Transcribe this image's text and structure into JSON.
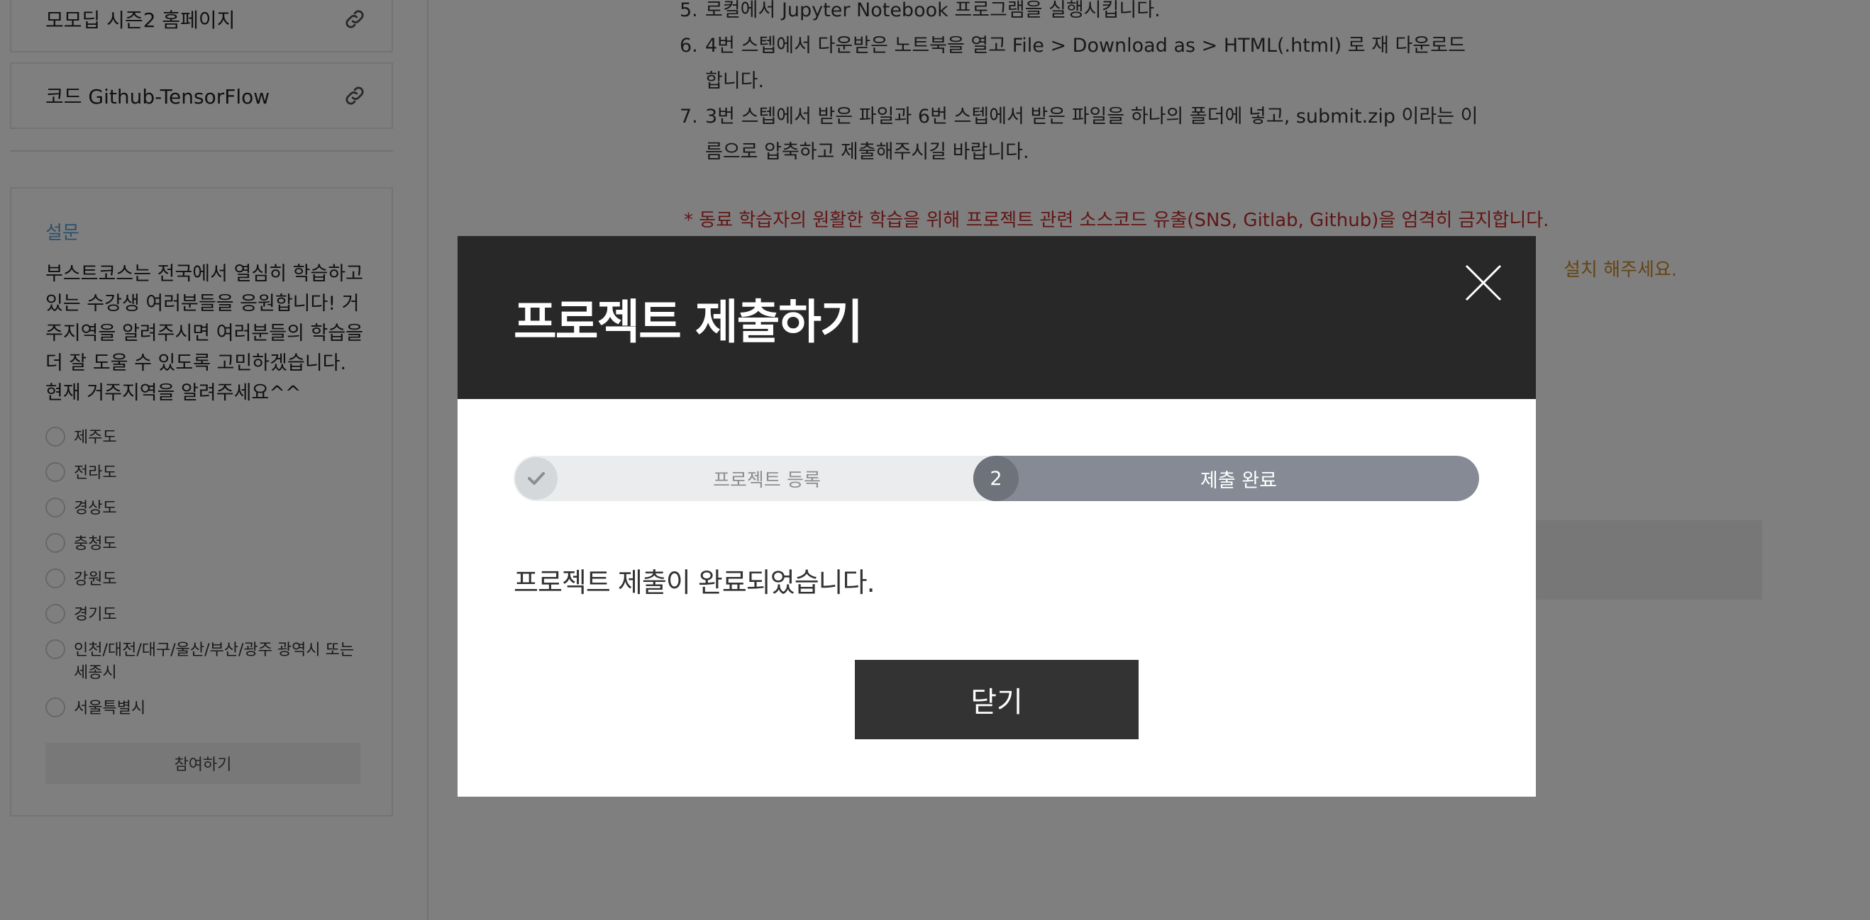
{
  "sidebar": {
    "links": [
      {
        "label": "모모딥 시즌2 홈페이지"
      },
      {
        "label": "코드 Github-TensorFlow"
      }
    ],
    "survey": {
      "title": "설문",
      "question": "부스트코스는 전국에서 열심히 학습하고 있는 수강생 여러분들을 응원합니다! 거주지역을 알려주시면 여러분들의 학습을 더 잘 도울 수 있도록 고민하겠습니다. 현재 거주지역을 알려주세요^^",
      "options": [
        {
          "label": "제주도"
        },
        {
          "label": "전라도"
        },
        {
          "label": "경상도"
        },
        {
          "label": "충청도"
        },
        {
          "label": "강원도"
        },
        {
          "label": "경기도"
        },
        {
          "label": "인천/대전/대구/울산/부산/광주 광역시 또는 세종시"
        },
        {
          "label": "서울특별시"
        }
      ],
      "submit_label": "참여하기"
    }
  },
  "main": {
    "steps": [
      {
        "num": "5.",
        "text": "로컬에서 Jupyter Notebook 프로그램을 실행시킵니다."
      },
      {
        "num": "6.",
        "text": "4번 스텝에서 다운받은 노트북을 열고 File > Download as > HTML(.html) 로 재 다운로드 합니다."
      },
      {
        "num": "7.",
        "text": "3번 스텝에서 받은 파일과 6번 스텝에서 받은 파일을 하나의 폴더에 넣고, submit.zip 이라는 이름으로 압축하고 제출해주시길 바랍니다."
      }
    ],
    "warning": "* 동료 학습자의 원활한 학습을 위해 프로젝트 관련 소스코드 유출(SNS, Gitlab, Github)을 엄격히 금지합니다.",
    "note_tail": "설치 해주세요."
  },
  "modal": {
    "title": "프로젝트 제출하기",
    "step1_label": "프로젝트 등록",
    "step2_num": "2",
    "step2_label": "제출 완료",
    "message": "프로젝트 제출이 완료되었습니다.",
    "close_button_label": "닫기"
  },
  "colors": {
    "modal_header": "#282828",
    "warning_text": "#c22d2d",
    "survey_title": "#5aa0d6",
    "stepper_active": "#858a94",
    "button_bg": "#333333"
  },
  "icons": [
    "link-icon",
    "check-icon",
    "close-icon"
  ]
}
